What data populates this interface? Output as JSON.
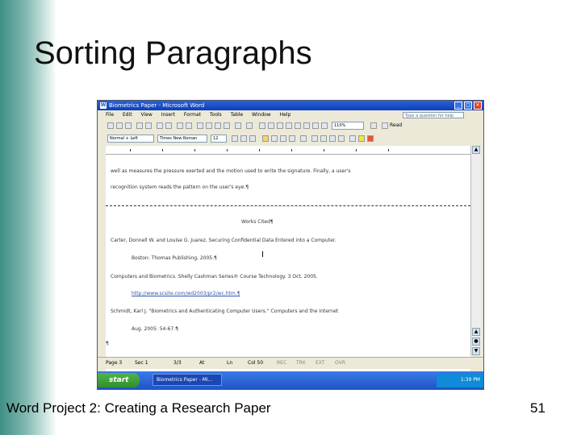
{
  "slide": {
    "title": "Sorting Paragraphs",
    "footer_left": "Word Project 2: Creating a Research Paper",
    "footer_right": "51"
  },
  "window": {
    "title": "Biometrics Paper - Microsoft Word",
    "app_icon": "W",
    "min_glyph": "_",
    "max_glyph": "□",
    "close_glyph": "✕"
  },
  "menu": {
    "items": [
      "File",
      "Edit",
      "View",
      "Insert",
      "Format",
      "Tools",
      "Table",
      "Window",
      "Help"
    ],
    "help_placeholder": "Type a question for help"
  },
  "toolbar": {
    "zoom": "110%",
    "read_label": "Read",
    "style": "Normal + Left",
    "font": "Times New Roman",
    "size": "12"
  },
  "document": {
    "lines": [
      "well as measures the pressure exerted and the motion used to write the signature. Finally, a user's",
      "recognition system reads the pattern on the user's eye.¶",
      "Works Cited¶",
      "Carter, Donnell W. and Louise G. Juarez. Securing Confidential Data Entered into a Computer.",
      "Boston: Thomas Publishing, 2005.¶",
      "Computers and Biometrics. Shelly Cashman Series® Course Technology. 3 Oct. 2005.",
      "http://www.scsite.com/wd2003/pr2/wc.htm.¶",
      "Schmidt, Karl J. \"Biometrics and Authenticating Computer Users.\" Computers and the Internet",
      "Aug. 2005: 54-67.¶",
      "¶"
    ],
    "page_break_label": "Page Break"
  },
  "status": {
    "items": [
      "Page 3",
      "Sec 1",
      "3/3",
      "At",
      "Ln",
      "Col 50",
      "REC",
      "TRK",
      "EXT",
      "OVR"
    ]
  },
  "taskbar": {
    "start": "start",
    "item": "Biometrics Paper - Mi...",
    "clock": "1:39 PM"
  },
  "colors": {
    "accent": "#3e8f86",
    "titlebar": "#0a3fb8",
    "start_green": "#2f8f2c"
  }
}
